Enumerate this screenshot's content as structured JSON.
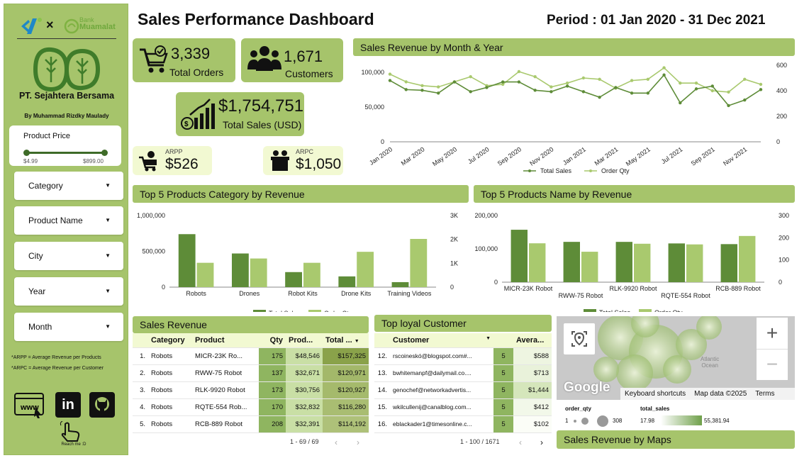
{
  "brand": {
    "bank_line1": "Bank",
    "bank_line2": "Muamalat",
    "company": "PT. Sejahtera Bersama",
    "author": "By Muhammad Rizdky Maulady"
  },
  "filters": {
    "price": {
      "label": "Product Price",
      "min": "$4.99",
      "max": "$899.00"
    },
    "dropdowns": [
      "Category",
      "Product Name",
      "City",
      "Year",
      "Month"
    ]
  },
  "notes": {
    "arpp": "*ARPP = Average Revenue per Products",
    "arpc": "*ARPC = Average Revenue per Customer"
  },
  "links": {
    "reach": "Reach me :D",
    "www": "www"
  },
  "header": {
    "title": "Sales Performance Dashboard",
    "period": "Period : 01 Jan 2020 - 31 Dec 2021"
  },
  "kpis": {
    "orders": {
      "value": "3,339",
      "label": "Total Orders"
    },
    "customers": {
      "value": "1,671",
      "label": "Customers"
    },
    "sales": {
      "value": "$1,754,751",
      "label": "Total Sales (USD)"
    },
    "arpp": {
      "label": "ARPP",
      "value": "$526"
    },
    "arpc": {
      "label": "ARPC",
      "value": "$1,050"
    }
  },
  "colors": {
    "dark": "#5e8c38",
    "light": "#a9c96e",
    "panel": "#a6c46b",
    "card": "#f2f9d2"
  },
  "chart_data": [
    {
      "type": "line",
      "title": "Sales Revenue by Month & Year",
      "x": [
        "Jan 2020",
        "Feb 2020",
        "Mar 2020",
        "Apr 2020",
        "May 2020",
        "Jun 2020",
        "Jul 2020",
        "Aug 2020",
        "Sep 2020",
        "Oct 2020",
        "Nov 2020",
        "Dec 2020",
        "Jan 2021",
        "Feb 2021",
        "Mar 2021",
        "Apr 2021",
        "May 2021",
        "Jun 2021",
        "Jul 2021",
        "Aug 2021",
        "Sep 2021",
        "Oct 2021",
        "Nov 2021",
        "Dec 2021"
      ],
      "xticks": [
        "Jan 2020",
        "Mar 2020",
        "May 2020",
        "Jul 2020",
        "Sep 2020",
        "Nov 2020",
        "Jan 2021",
        "Mar 2021",
        "May 2021",
        "Jul 2021",
        "Sep 2021",
        "Nov 2021"
      ],
      "series": [
        {
          "name": "Total Sales",
          "axis": "left",
          "values": [
            88000,
            75000,
            74000,
            70000,
            86000,
            72000,
            78000,
            86000,
            86000,
            74000,
            72000,
            80000,
            72000,
            64000,
            78000,
            70000,
            70000,
            96000,
            56000,
            76000,
            80000,
            52000,
            60000,
            75000
          ]
        },
        {
          "name": "Order Qty",
          "axis": "right",
          "values": [
            530,
            470,
            440,
            430,
            470,
            510,
            440,
            450,
            550,
            510,
            430,
            460,
            500,
            490,
            420,
            480,
            490,
            580,
            460,
            460,
            400,
            390,
            490,
            450
          ]
        }
      ],
      "yticks_left": [
        "0",
        "50,000",
        "100,000"
      ],
      "ylim_left": [
        0,
        110000
      ],
      "yticks_right": [
        "0",
        "200",
        "400",
        "600"
      ],
      "ylim_right": [
        0,
        600
      ]
    },
    {
      "type": "bar",
      "title": "Top 5 Products Category by Revenue",
      "categories": [
        "Robots",
        "Drones",
        "Robot Kits",
        "Drone Kits",
        "Training Videos"
      ],
      "series": [
        {
          "name": "Total Sales",
          "axis": "left",
          "values": [
            740000,
            470000,
            210000,
            150000,
            70000
          ]
        },
        {
          "name": "Order Qty",
          "axis": "right",
          "values": [
            1020,
            1200,
            1020,
            1480,
            2020
          ]
        }
      ],
      "yticks_left": [
        "0",
        "500,000",
        "1,000,000"
      ],
      "ylim_left": [
        0,
        1000000
      ],
      "yticks_right": [
        "0",
        "1K",
        "2K",
        "3K"
      ],
      "ylim_right": [
        0,
        3000
      ]
    },
    {
      "type": "bar",
      "title": "Top 5 Products Name by Revenue",
      "categories": [
        "MICR-23K Robot",
        "RWW-75 Robot",
        "RLK-9920 Robot",
        "RQTE-554 Robot",
        "RCB-889 Robot"
      ],
      "series": [
        {
          "name": "Total Sales",
          "axis": "left",
          "values": [
            157325,
            120971,
            120927,
            116280,
            114192
          ]
        },
        {
          "name": "Order Qty",
          "axis": "right",
          "values": [
            175,
            137,
            173,
            170,
            208
          ]
        }
      ],
      "yticks_left": [
        "0",
        "100,000",
        "200,000"
      ],
      "ylim_left": [
        0,
        200000
      ],
      "yticks_right": [
        "0",
        "100",
        "200",
        "300"
      ],
      "ylim_right": [
        0,
        300
      ]
    }
  ],
  "sales_table": {
    "title": "Sales Revenue",
    "headers": [
      "Category",
      "Product",
      "Qty",
      "Prod...",
      "Total ..."
    ],
    "rows": [
      [
        "1.",
        "Robots",
        "MICR-23K Ro...",
        "175",
        "$48,546",
        "$157,325"
      ],
      [
        "2.",
        "Robots",
        "RWW-75 Robot",
        "137",
        "$32,671",
        "$120,971"
      ],
      [
        "3.",
        "Robots",
        "RLK-9920 Robot",
        "173",
        "$30,756",
        "$120,927"
      ],
      [
        "4.",
        "Robots",
        "RQTE-554 Rob...",
        "170",
        "$32,832",
        "$116,280"
      ],
      [
        "5.",
        "Robots",
        "RCB-889 Robot",
        "208",
        "$32,391",
        "$114,192"
      ]
    ],
    "pager": "1 - 69 / 69"
  },
  "customer_table": {
    "title": "Top loyal Customer",
    "headers": [
      "Customer",
      "Avera..."
    ],
    "rows": [
      [
        "12.",
        "rscoineskó@blogspot.com#...",
        "5",
        "$588"
      ],
      [
        "13.",
        "bwhitemanpf@dailymail.co....",
        "5",
        "$713"
      ],
      [
        "14.",
        "genochef@networkadvertis...",
        "5",
        "$1,444"
      ],
      [
        "15.",
        "wkilcullenij@canalblog.com...",
        "5",
        "$412"
      ],
      [
        "16.",
        "eblackader1@timesonline.c...",
        "5",
        "$102"
      ]
    ],
    "pager": "1 - 100 / 1671"
  },
  "map": {
    "title": "Sales Revenue by Maps",
    "ocean": "Atlantic\nOcean",
    "logo": "Google",
    "shortcuts": "Keyboard shortcuts",
    "attribution": "Map data ©2025",
    "terms": "Terms",
    "zoom_in": "+",
    "zoom_out": "−",
    "legend_qty_title": "order_qty",
    "legend_qty_min": "1",
    "legend_qty_max": "308",
    "legend_sales_title": "total_sales",
    "legend_sales_min": "17.98",
    "legend_sales_max": "55,381.94"
  }
}
